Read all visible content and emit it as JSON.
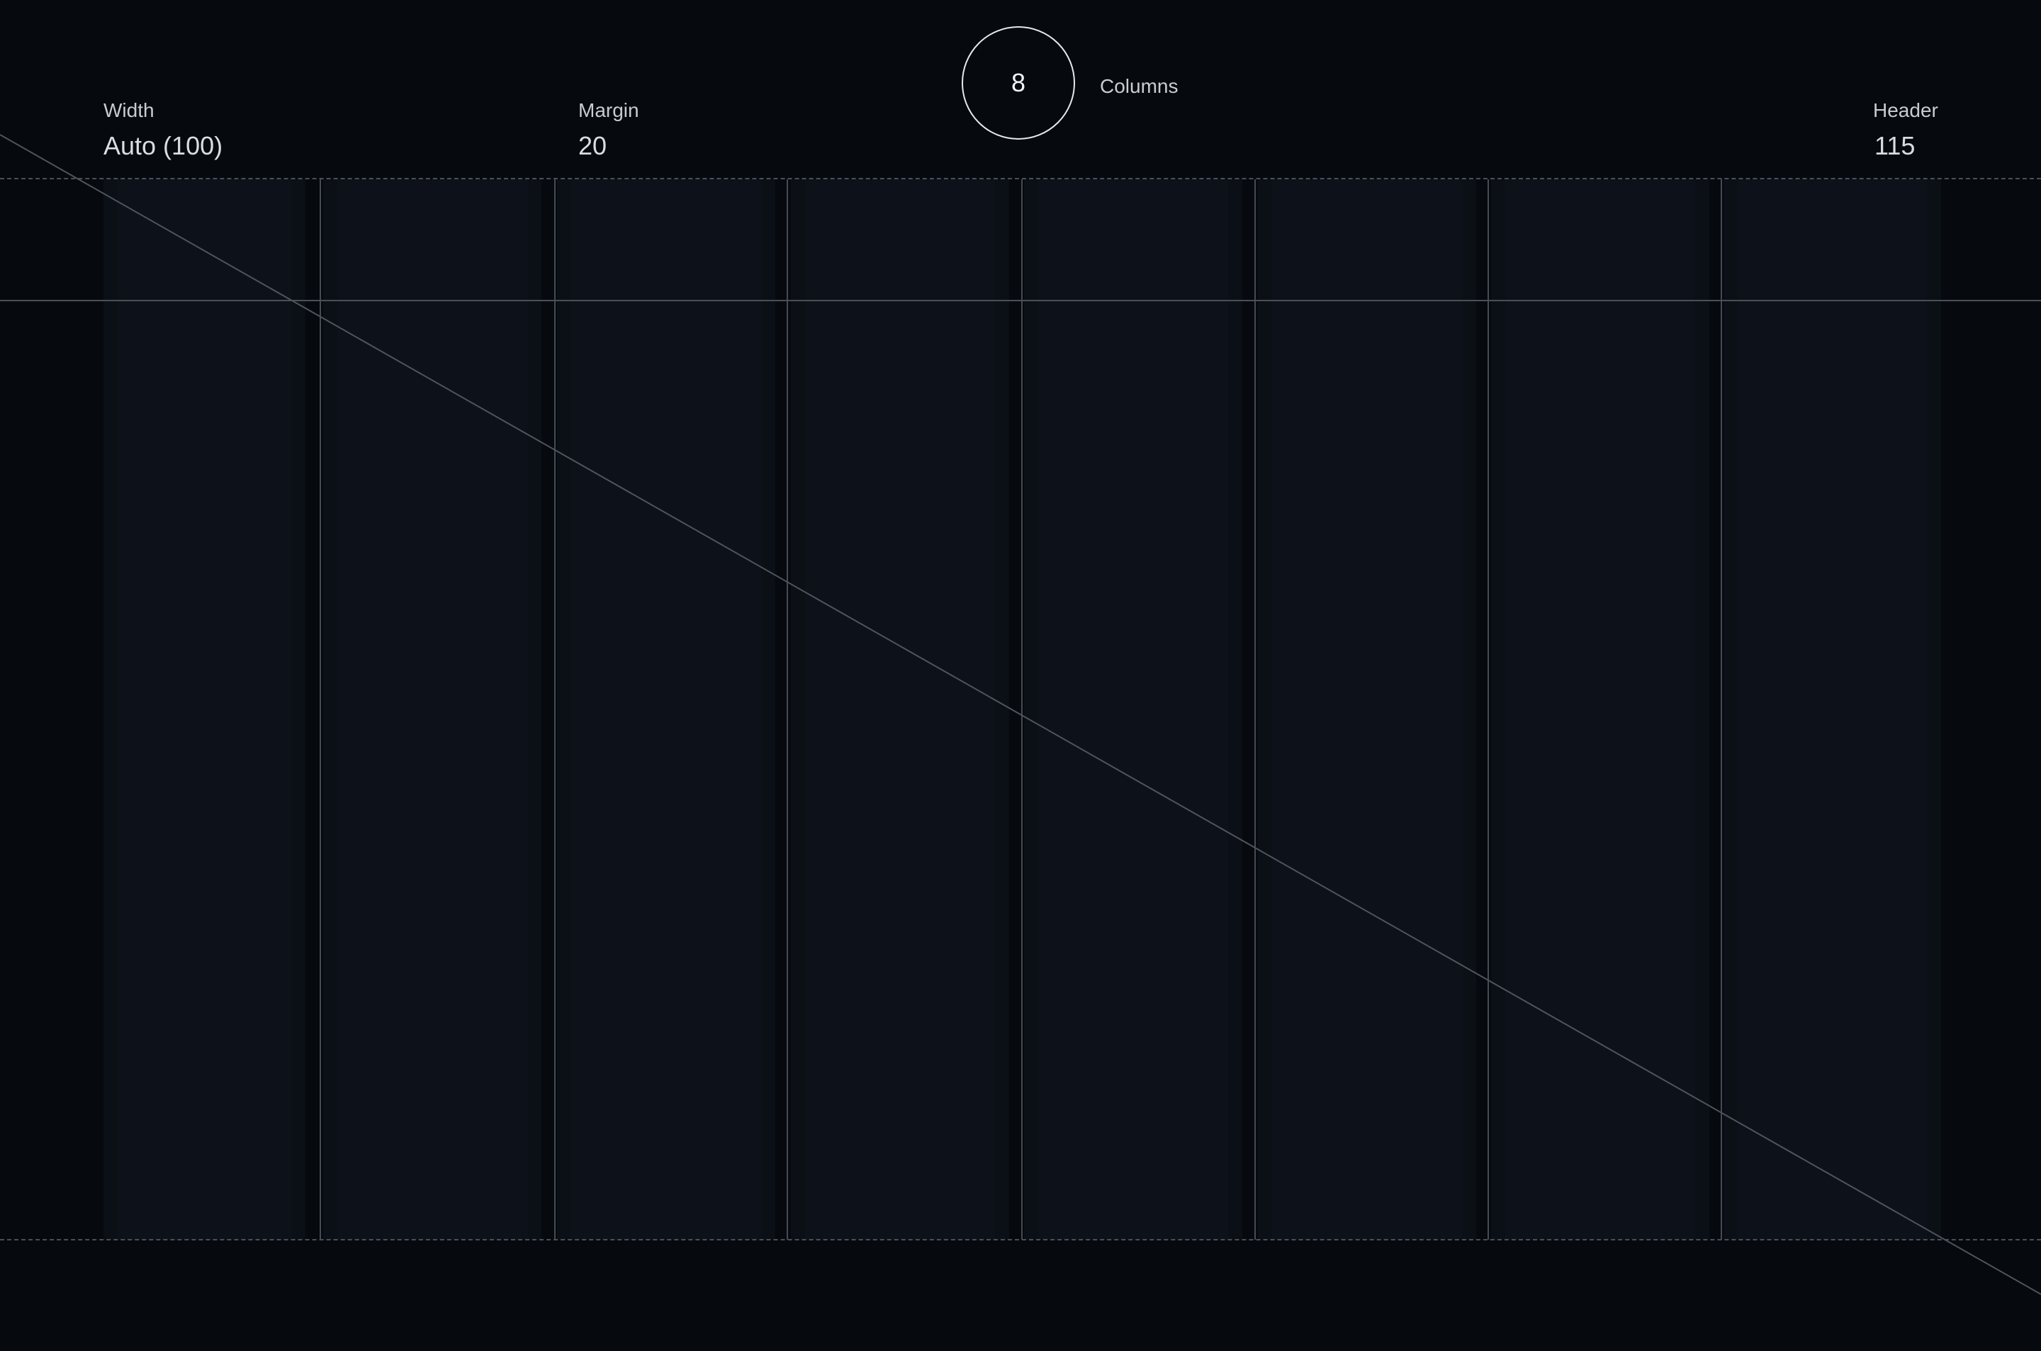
{
  "grid": {
    "columns_count": "8",
    "columns_label": "Columns"
  },
  "settings": {
    "width": {
      "label": "Width",
      "value": "Auto (100)"
    },
    "margin": {
      "label": "Margin",
      "value": "20"
    },
    "header": {
      "label": "Header",
      "value": "115"
    }
  },
  "colors": {
    "background": "#05080d",
    "column_fill": "#0b0f16",
    "guide_line": "#4b4f58",
    "text": "#d2d6dc",
    "accent": "#e6e8eb"
  }
}
